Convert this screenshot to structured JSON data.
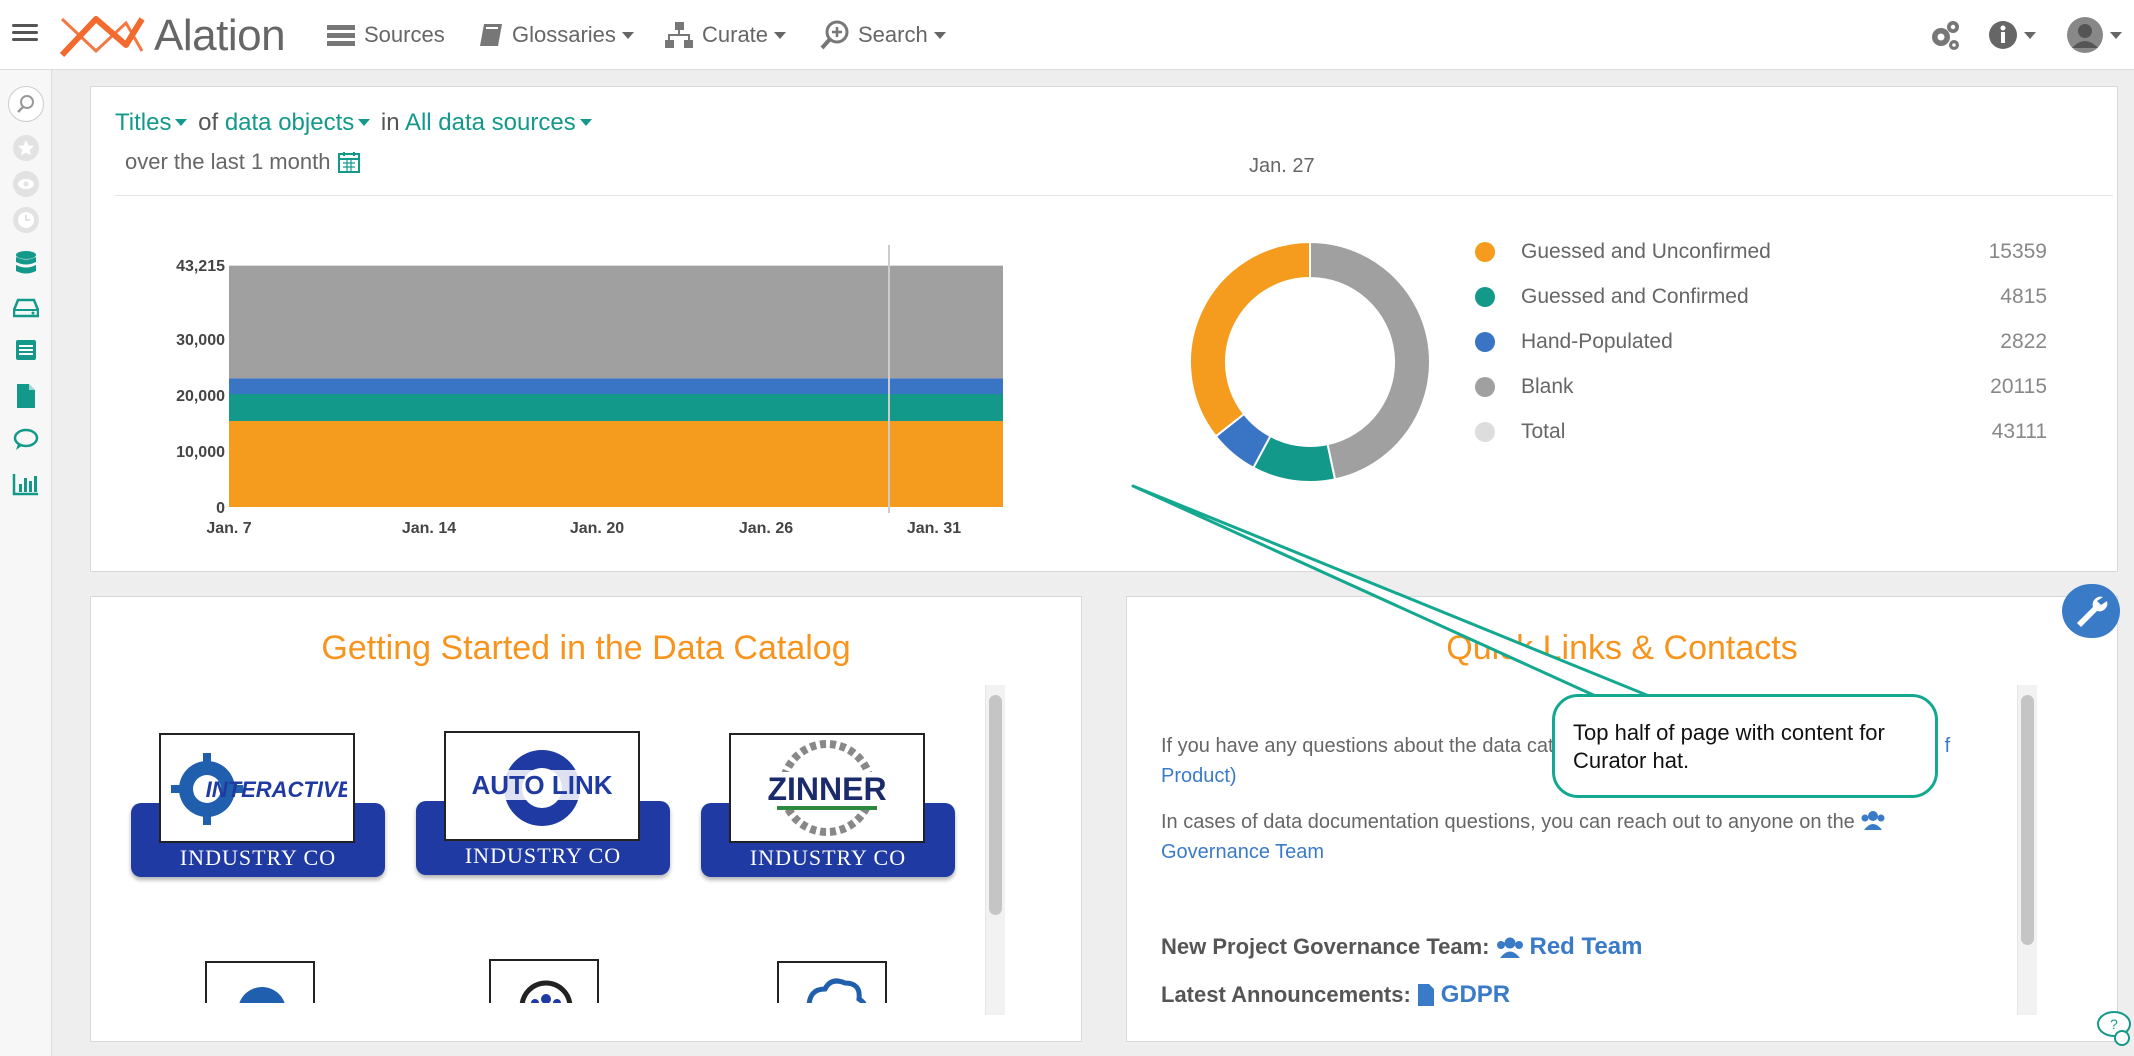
{
  "app": {
    "name": "Alation"
  },
  "nav": {
    "sources": "Sources",
    "glossaries": "Glossaries",
    "curate": "Curate",
    "search": "Search"
  },
  "filter": {
    "metric": "Titles",
    "of": "of",
    "objects": "data objects",
    "in": "in",
    "scope": "All data sources",
    "period": "over the last 1 month",
    "selected_date": "Jan. 27"
  },
  "chart_data": [
    {
      "type": "area",
      "stacked": true,
      "x": [
        "Jan. 7",
        "Jan. 14",
        "Jan. 20",
        "Jan. 26",
        "Jan. 31"
      ],
      "ytick_labels": [
        "0",
        "10,000",
        "20,000",
        "30,000",
        "43,215"
      ],
      "ylim": [
        0,
        43215
      ],
      "series": [
        {
          "name": "Guessed and Unconfirmed",
          "color": "#f59c1e",
          "values": [
            15359,
            15359,
            15359,
            15359,
            15359
          ]
        },
        {
          "name": "Guessed and Confirmed",
          "color": "#13998a",
          "values": [
            4815,
            4815,
            4815,
            4815,
            4815
          ]
        },
        {
          "name": "Hand-Populated",
          "color": "#3a74c4",
          "values": [
            2822,
            2822,
            2822,
            2822,
            2822
          ]
        },
        {
          "name": "Blank",
          "color": "#a0a0a0",
          "values": [
            20115,
            20115,
            20115,
            20115,
            20115
          ]
        }
      ],
      "cursor_at": "Jan. 27"
    },
    {
      "type": "pie",
      "donut": true,
      "labels": [
        "Guessed and Unconfirmed",
        "Guessed and Confirmed",
        "Hand-Populated",
        "Blank",
        "Total"
      ],
      "values": [
        15359,
        4815,
        2822,
        20115,
        43111
      ],
      "colors": [
        "#f59c1e",
        "#13998a",
        "#3a74c4",
        "#a0a0a0",
        "#dddddd"
      ]
    }
  ],
  "getting_started": {
    "title": "Getting Started in the Data Catalog",
    "cards": [
      {
        "brand": "INTERACTIVE",
        "caption": "INDUSTRY CO"
      },
      {
        "brand": "AUTO LINK",
        "caption": "INDUSTRY CO"
      },
      {
        "brand": "ZINNER",
        "caption": "INDUSTRY CO"
      }
    ]
  },
  "quick_links": {
    "title": "Quick Links & Contacts",
    "line1": "If you have any questions about the data cata",
    "line1_end": "f",
    "line1_link": "Product)",
    "line2": "In cases of data documentation questions, you can reach out to anyone on the",
    "line2_link": "Governance Team",
    "project_label": "New Project Governance Team:",
    "project_link": "Red Team",
    "announce_label": "Latest Announcements:",
    "announce_link": "GDPR"
  },
  "callout": {
    "text": "Top half of page with content for Curator hat."
  }
}
